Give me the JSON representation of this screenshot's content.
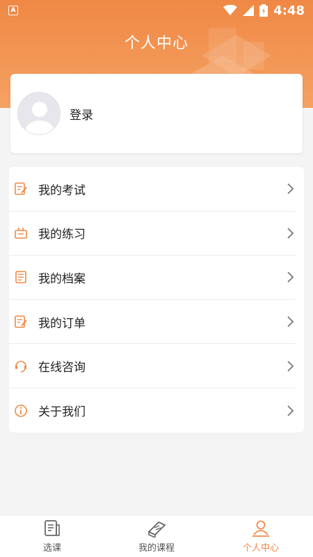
{
  "status_bar": {
    "app_badge": "A",
    "time": "4:48"
  },
  "header": {
    "title": "个人中心"
  },
  "login_card": {
    "label": "登录"
  },
  "menu": {
    "items": [
      {
        "label": "我的考试",
        "icon": "exam-icon"
      },
      {
        "label": "我的练习",
        "icon": "practice-icon"
      },
      {
        "label": "我的档案",
        "icon": "archive-icon"
      },
      {
        "label": "我的订单",
        "icon": "order-icon"
      },
      {
        "label": "在线咨询",
        "icon": "consult-icon"
      },
      {
        "label": "关于我们",
        "icon": "info-icon"
      }
    ]
  },
  "tabbar": {
    "tabs": [
      {
        "label": "选课",
        "icon": "course-select-icon",
        "active": false
      },
      {
        "label": "我的课程",
        "icon": "my-courses-icon",
        "active": false
      },
      {
        "label": "个人中心",
        "icon": "profile-icon",
        "active": true
      }
    ]
  },
  "colors": {
    "accent": "#f08845",
    "background": "#f4f4f4",
    "text": "#222222"
  }
}
